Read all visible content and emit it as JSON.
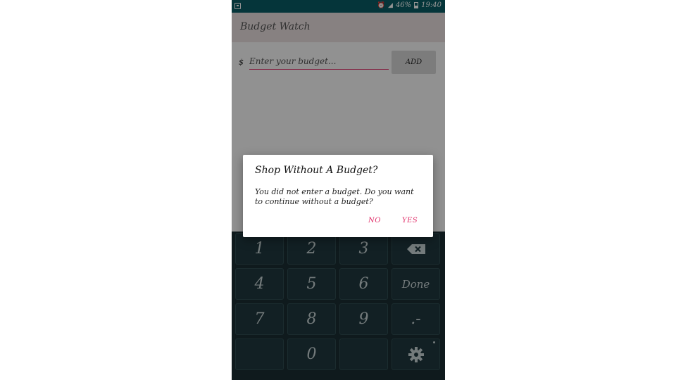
{
  "status_bar": {
    "battery": "46%",
    "time": "19:40"
  },
  "app_bar": {
    "title": "Budget Watch"
  },
  "budget_form": {
    "currency_symbol": "$",
    "placeholder": "Enter your budget...",
    "value": "",
    "add_label": "ADD"
  },
  "dialog": {
    "title": "Shop Without A Budget?",
    "message": "You did not enter a budget. Do you want to continue without a budget?",
    "no_label": "NO",
    "yes_label": "YES"
  },
  "keyboard": {
    "keys": [
      "1",
      "2",
      "3",
      "4",
      "5",
      "6",
      "Done",
      "7",
      "8",
      "9",
      ".-",
      "0"
    ]
  },
  "colors": {
    "status_bar": "#0a5c64",
    "accent": "#e0306a",
    "keyboard_bg": "#1a2e33"
  },
  "icons": [
    "screenshot-icon",
    "alarm-icon",
    "signal-icon",
    "battery-icon",
    "backspace-icon",
    "gear-icon"
  ]
}
